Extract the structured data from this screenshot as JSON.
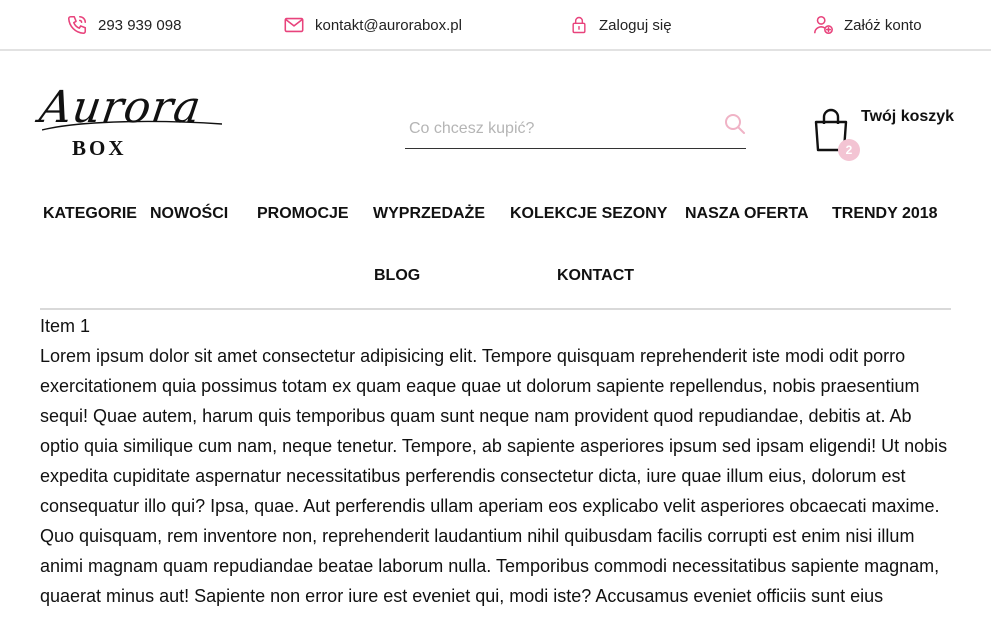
{
  "topbar": {
    "phone": "293 939 098",
    "email": "kontakt@aurorabox.pl",
    "login": "Zaloguj się",
    "register": "Załóż konto",
    "accent_color": "#e8437c"
  },
  "header": {
    "logo_script": "Aurora",
    "logo_box": "BOX",
    "search_placeholder": "Co chcesz kupić?",
    "cart_label": "Twój koszyk",
    "cart_count": "2"
  },
  "nav": {
    "row1": [
      "KATEGORIE",
      "NOWOŚCI",
      "PROMOCJE",
      "WYPRZEDAŻE",
      "KOLEKCJE SEZONY",
      "NASZA OFERTA",
      "TRENDY 2018"
    ],
    "row2": [
      "BLOG",
      "KONTACT"
    ]
  },
  "content": {
    "title": "Item 1",
    "body": "Lorem ipsum dolor sit amet consectetur adipisicing elit. Tempore quisquam reprehenderit iste modi odit porro exercitationem quia possimus totam ex quam eaque quae ut dolorum sapiente repellendus, nobis praesentium sequi! Quae autem, harum quis temporibus quam sunt neque nam provident quod repudiandae, debitis at. Ab optio quia similique cum nam, neque tenetur. Tempore, ab sapiente asperiores ipsum sed ipsam eligendi! Ut nobis expedita cupiditate aspernatur necessitatibus perferendis consectetur dicta, iure quae illum eius, dolorum est consequatur illo qui? Ipsa, quae. Aut perferendis ullam aperiam eos explicabo velit asperiores obcaecati maxime. Quo quisquam, rem inventore non, reprehenderit laudantium nihil quibusdam facilis corrupti est enim nisi illum animi magnam quam repudiandae beatae laborum nulla. Temporibus commodi necessitatibus sapiente magnam, quaerat minus aut! Sapiente non error iure est eveniet qui, modi iste? Accusamus eveniet officiis sunt eius"
  }
}
